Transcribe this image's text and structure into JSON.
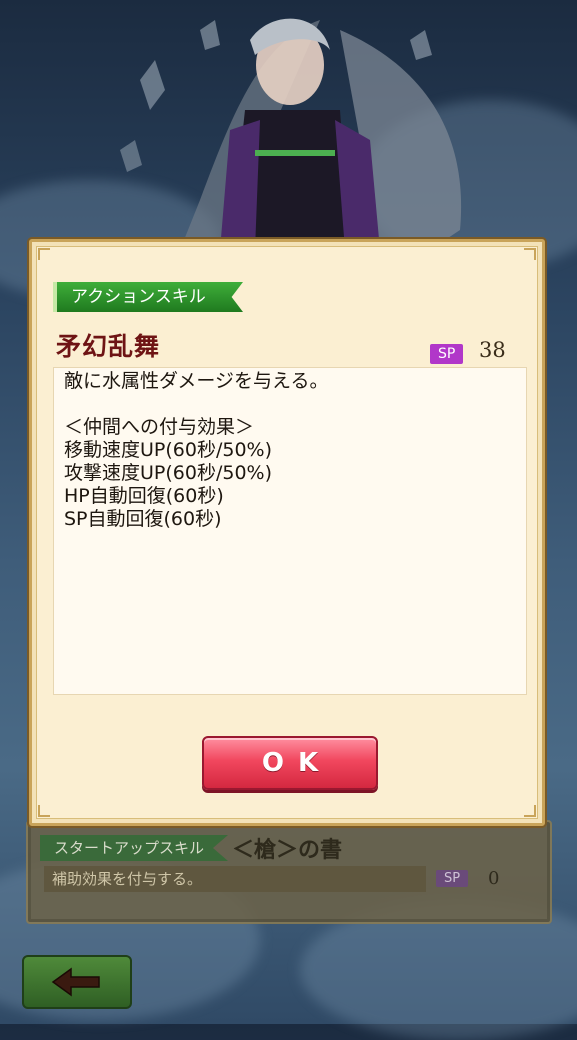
{
  "dialog": {
    "category_label": "アクションスキル",
    "skill_name": "矛幻乱舞",
    "sp_label": "SP",
    "sp_value": "38",
    "description_lines": [
      "敵に水属性ダメージを与える。",
      "",
      "＜仲間への付与効果＞",
      "移動速度UP(60秒/50%)",
      "攻撃速度UP(60秒/50%)",
      "HP自動回復(60秒)",
      "SP自動回復(60秒)"
    ],
    "ok_label": "OK"
  },
  "background_panel": {
    "category_label": "スタートアップスキル",
    "skill_name": "＜槍＞の書",
    "description": "補助効果を付与する。",
    "sp_label": "SP",
    "sp_value": "0"
  },
  "back_button": {
    "icon": "back-arrow-icon"
  },
  "colors": {
    "ribbon_green": "#2f9a2c",
    "skill_name_red": "#6e1414",
    "sp_purple": "#b137c9",
    "ok_red": "#f1475e",
    "panel_cream": "#fbefd2",
    "frame_gold": "#c9a45a"
  }
}
